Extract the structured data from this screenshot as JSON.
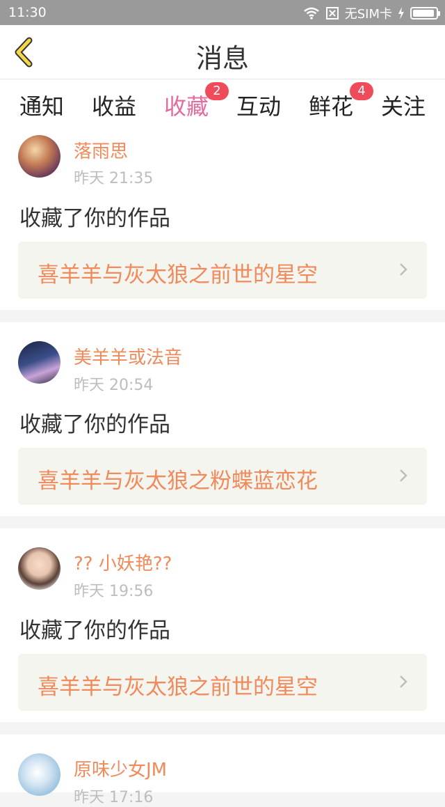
{
  "status_bar": {
    "time": "11:30",
    "sim_text": "无SIM卡",
    "battery_level": 0.95
  },
  "nav": {
    "title": "消息",
    "back_icon": "chevron-left-icon",
    "accent_color": "#f4d64b"
  },
  "tabs": [
    {
      "label": "通知",
      "badge": ""
    },
    {
      "label": "收益",
      "badge": ""
    },
    {
      "label": "收藏",
      "badge": "2",
      "active": true
    },
    {
      "label": "互动",
      "badge": ""
    },
    {
      "label": "鲜花",
      "badge": "4"
    },
    {
      "label": "关注",
      "badge": ""
    }
  ],
  "colors": {
    "active_tab": "#e56a9e",
    "badge": "#f04b5a",
    "username": "#f08a5a",
    "work_title": "#f08a5a"
  },
  "messages": [
    {
      "username": "落雨思",
      "time": "昨天 21:35",
      "action": "收藏了你的作品",
      "work": "喜羊羊与灰太狼之前世的星空"
    },
    {
      "username": "美羊羊或法音",
      "time": "昨天 20:54",
      "action": "收藏了你的作品",
      "work": "喜羊羊与灰太狼之粉蝶蓝恋花"
    },
    {
      "username": "?? 小妖艳??",
      "time": "昨天 19:56",
      "action": "收藏了你的作品",
      "work": "喜羊羊与灰太狼之前世的星空"
    },
    {
      "username": "原味少女JM",
      "time": "昨天 17:16",
      "action": "",
      "work": ""
    }
  ]
}
